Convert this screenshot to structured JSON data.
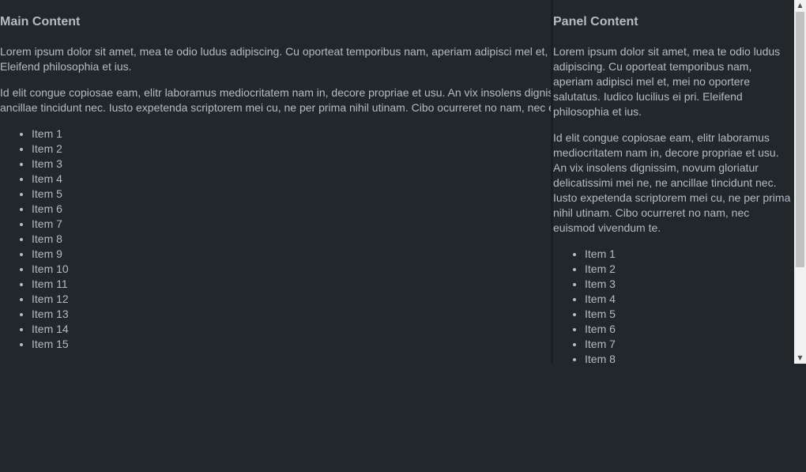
{
  "main": {
    "heading": "Main Content",
    "paragraph_1_line_1": "Lorem ipsum dolor sit amet, mea te odio ludus adipiscing. Cu oporteat temporibus nam, aperiam adipisci mel et, mei no oportere salutatus. Iudico lucilius ei pri.",
    "paragraph_1_line_2": "Eleifend philosophia et ius.",
    "paragraph_2_line_1": "Id elit congue copiosae eam, elitr laboramus mediocritatem nam in, decore propriae et usu. An vix insolens dignissim, novum gloriatur delicatissimi mei ne, ne",
    "paragraph_2_line_2": "ancillae tincidunt nec. Iusto expetenda scriptorem mei cu, ne per prima nihil utinam. Cibo ocurreret no nam, nec euismod vivendum te.",
    "items": [
      "Item 1",
      "Item 2",
      "Item 3",
      "Item 4",
      "Item 5",
      "Item 6",
      "Item 7",
      "Item 8",
      "Item 9",
      "Item 10",
      "Item 11",
      "Item 12",
      "Item 13",
      "Item 14",
      "Item 15"
    ]
  },
  "panel": {
    "heading": "Panel Content",
    "paragraph_1": "Lorem ipsum dolor sit amet, mea te odio ludus adipiscing. Cu oporteat temporibus nam, aperiam adipisci mel et, mei no oportere salutatus. Iudico lucilius ei pri. Eleifend philosophia et ius.",
    "paragraph_2": "Id elit congue copiosae eam, elitr laboramus mediocritatem nam in, decore propriae et usu. An vix insolens dignissim, novum gloriatur delicatissimi mei ne, ne ancillae tincidunt nec. Iusto expetenda scriptorem mei cu, ne per prima nihil utinam. Cibo ocurreret no nam, nec euismod vivendum te.",
    "items": [
      "Item 1",
      "Item 2",
      "Item 3",
      "Item 4",
      "Item 5",
      "Item 6",
      "Item 7",
      "Item 8"
    ]
  },
  "scrollbar": {
    "up_arrow_icon": "triangle-up",
    "down_arrow_icon": "triangle-down",
    "up_glyph": "▲",
    "down_glyph": "▼"
  },
  "colors": {
    "background": "#22272b",
    "text": "#b4bcc2",
    "scrollbar_track": "#f1f1f1",
    "scrollbar_thumb": "#c1c1c1"
  }
}
